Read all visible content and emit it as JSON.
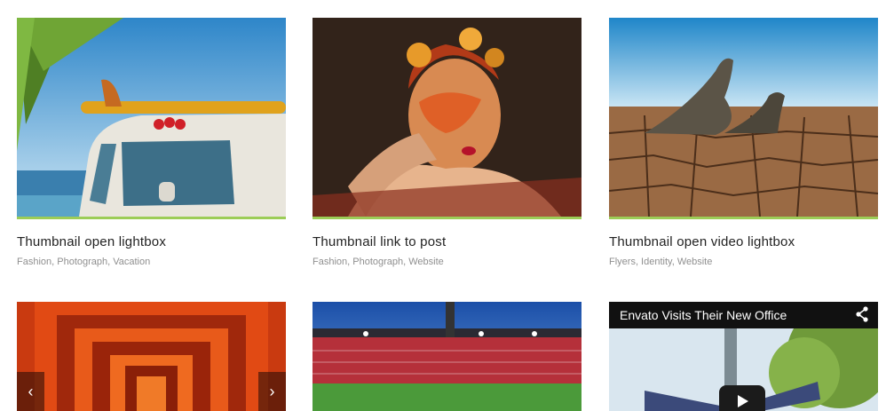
{
  "portfolio": {
    "items": [
      {
        "title": "Thumbnail open lightbox",
        "tags": "Fashion, Photograph, Vacation",
        "image": "beach-van-surfboard"
      },
      {
        "title": "Thumbnail link to post",
        "tags": "Fashion, Photograph, Website",
        "image": "woman-rose-makeup"
      },
      {
        "title": "Thumbnail open video lightbox",
        "tags": "Flyers, Identity, Website",
        "image": "seals-cracked-earth"
      }
    ],
    "row2": [
      {
        "image": "red-torii-gates",
        "prev_icon": "‹",
        "next_icon": "›"
      },
      {
        "image": "stadium"
      },
      {
        "video_title": "Envato Visits Their New Office",
        "image": "street-sign-video"
      }
    ]
  },
  "accent_color": "#9ccd57"
}
